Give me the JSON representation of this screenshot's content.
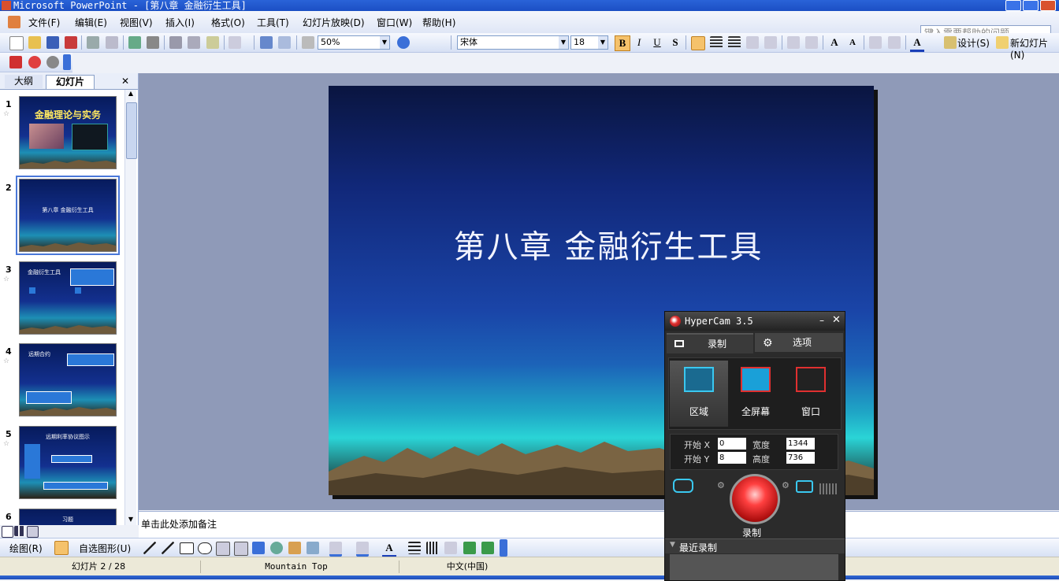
{
  "window": {
    "title": "Microsoft PowerPoint - [第八章 金融衍生工具]"
  },
  "menu": [
    "文件(F)",
    "编辑(E)",
    "视图(V)",
    "插入(I)",
    "格式(O)",
    "工具(T)",
    "幻灯片放映(D)",
    "窗口(W)",
    "帮助(H)"
  ],
  "help": {
    "placeholder": "键入需要帮助的问题"
  },
  "toolbar": {
    "zoom": "50%",
    "font": "宋体",
    "size": "18",
    "bold": "B",
    "italic": "I",
    "underline": "U",
    "shadow": "S",
    "design_label": "设计(S)",
    "new_slide_label": "新幻灯片(N)"
  },
  "sidepane": {
    "tab_outline": "大纲",
    "tab_slides": "幻灯片",
    "thumbs": [
      {
        "num": "1",
        "title": "金融理论与实务"
      },
      {
        "num": "2",
        "title": "第八章 金融衍生工具"
      },
      {
        "num": "3",
        "title": "金融衍生工具"
      },
      {
        "num": "4",
        "title": "远期合约"
      },
      {
        "num": "5",
        "title": "远期利率协议图示"
      },
      {
        "num": "6",
        "title": "习题"
      }
    ]
  },
  "slide": {
    "title": "第八章 金融衍生工具"
  },
  "notes": {
    "placeholder": "单击此处添加备注"
  },
  "drawbar": {
    "draw_label": "绘图(R)",
    "autoshape_label": "自选图形(U)"
  },
  "status": {
    "slide_info": "幻灯片 2 / 28",
    "design": "Mountain Top",
    "language": "中文(中国)"
  },
  "hypercam": {
    "title": "HyperCam 3.5",
    "tab_record": "录制",
    "tab_options": "选项",
    "modes": [
      "区域",
      "全屏幕",
      "窗口"
    ],
    "start_x_label": "开始 X",
    "start_y_label": "开始 Y",
    "width_label": "宽度",
    "height_label": "高度",
    "start_x": "0",
    "start_y": "8",
    "width": "1344",
    "height": "736",
    "record_label": "录制",
    "recent_label": "最近录制"
  },
  "colors": {
    "title_bar": "#1b4fc4",
    "slide_bg_top": "#0a1540",
    "slide_bg_mid": "#1a45a8",
    "accent_cyan": "#2ad4d6",
    "record_red": "#e03030"
  }
}
